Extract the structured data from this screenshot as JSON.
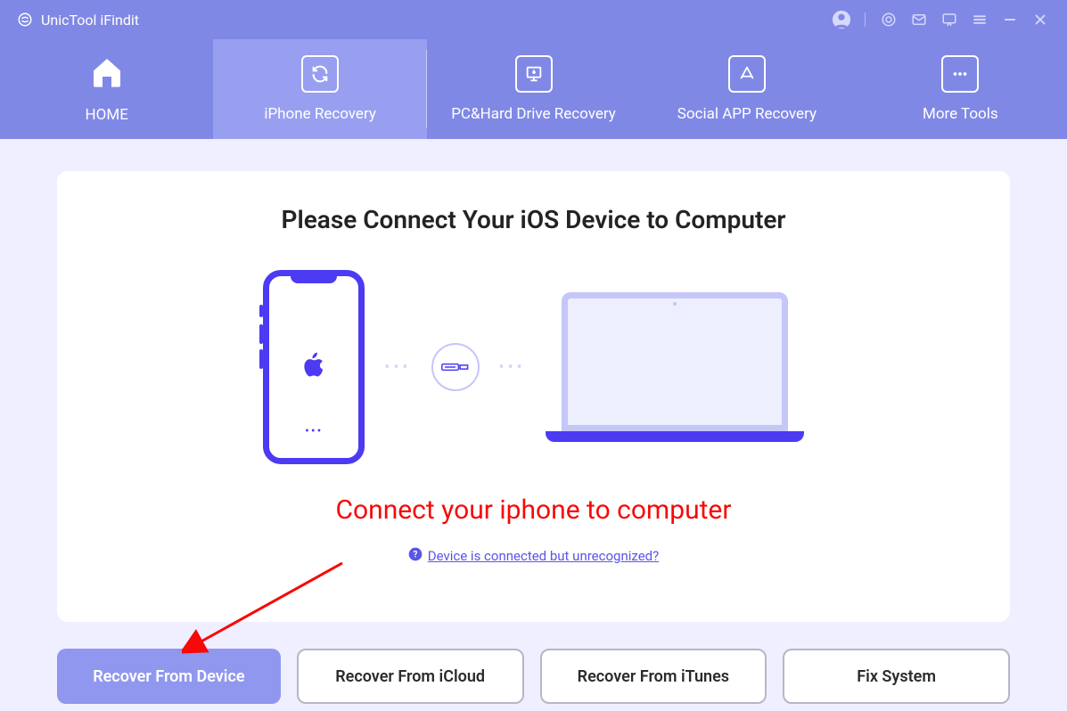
{
  "app": {
    "title": "UnicTool iFindit"
  },
  "nav": {
    "home": "HOME",
    "iphone_recovery": "iPhone Recovery",
    "pc_recovery": "PC&Hard Drive Recovery",
    "social_recovery": "Social APP Recovery",
    "more_tools": "More Tools"
  },
  "main": {
    "title": "Please Connect Your iOS Device to Computer",
    "annotation": "Connect your iphone to computer",
    "help_link": "Device is connected but unrecognized?"
  },
  "buttons": {
    "recover_device": "Recover From Device",
    "recover_icloud": "Recover From iCloud",
    "recover_itunes": "Recover From iTunes",
    "fix_system": "Fix System"
  }
}
